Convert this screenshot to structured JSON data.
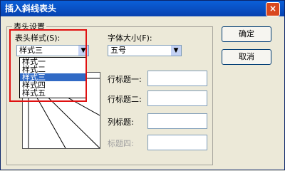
{
  "window": {
    "title": "插入斜线表头",
    "close_glyph": "×"
  },
  "group": {
    "label": "表头设置"
  },
  "style_field": {
    "label": "表头样式(S):",
    "value": "样式三",
    "options": [
      "样式一",
      "样式二",
      "样式三",
      "样式四",
      "样式五"
    ],
    "selected_index": 2
  },
  "font_size": {
    "label": "字体大小(F):",
    "value": "五号"
  },
  "row_title_1": {
    "label": "行标题一:"
  },
  "row_title_2": {
    "label": "行标题二:"
  },
  "col_title": {
    "label": "列标题:"
  },
  "title_4": {
    "label": "标题四:"
  },
  "buttons": {
    "ok": "确定",
    "cancel": "取消"
  },
  "colors": {
    "highlight": "#e01010",
    "selection": "#316ac5"
  }
}
